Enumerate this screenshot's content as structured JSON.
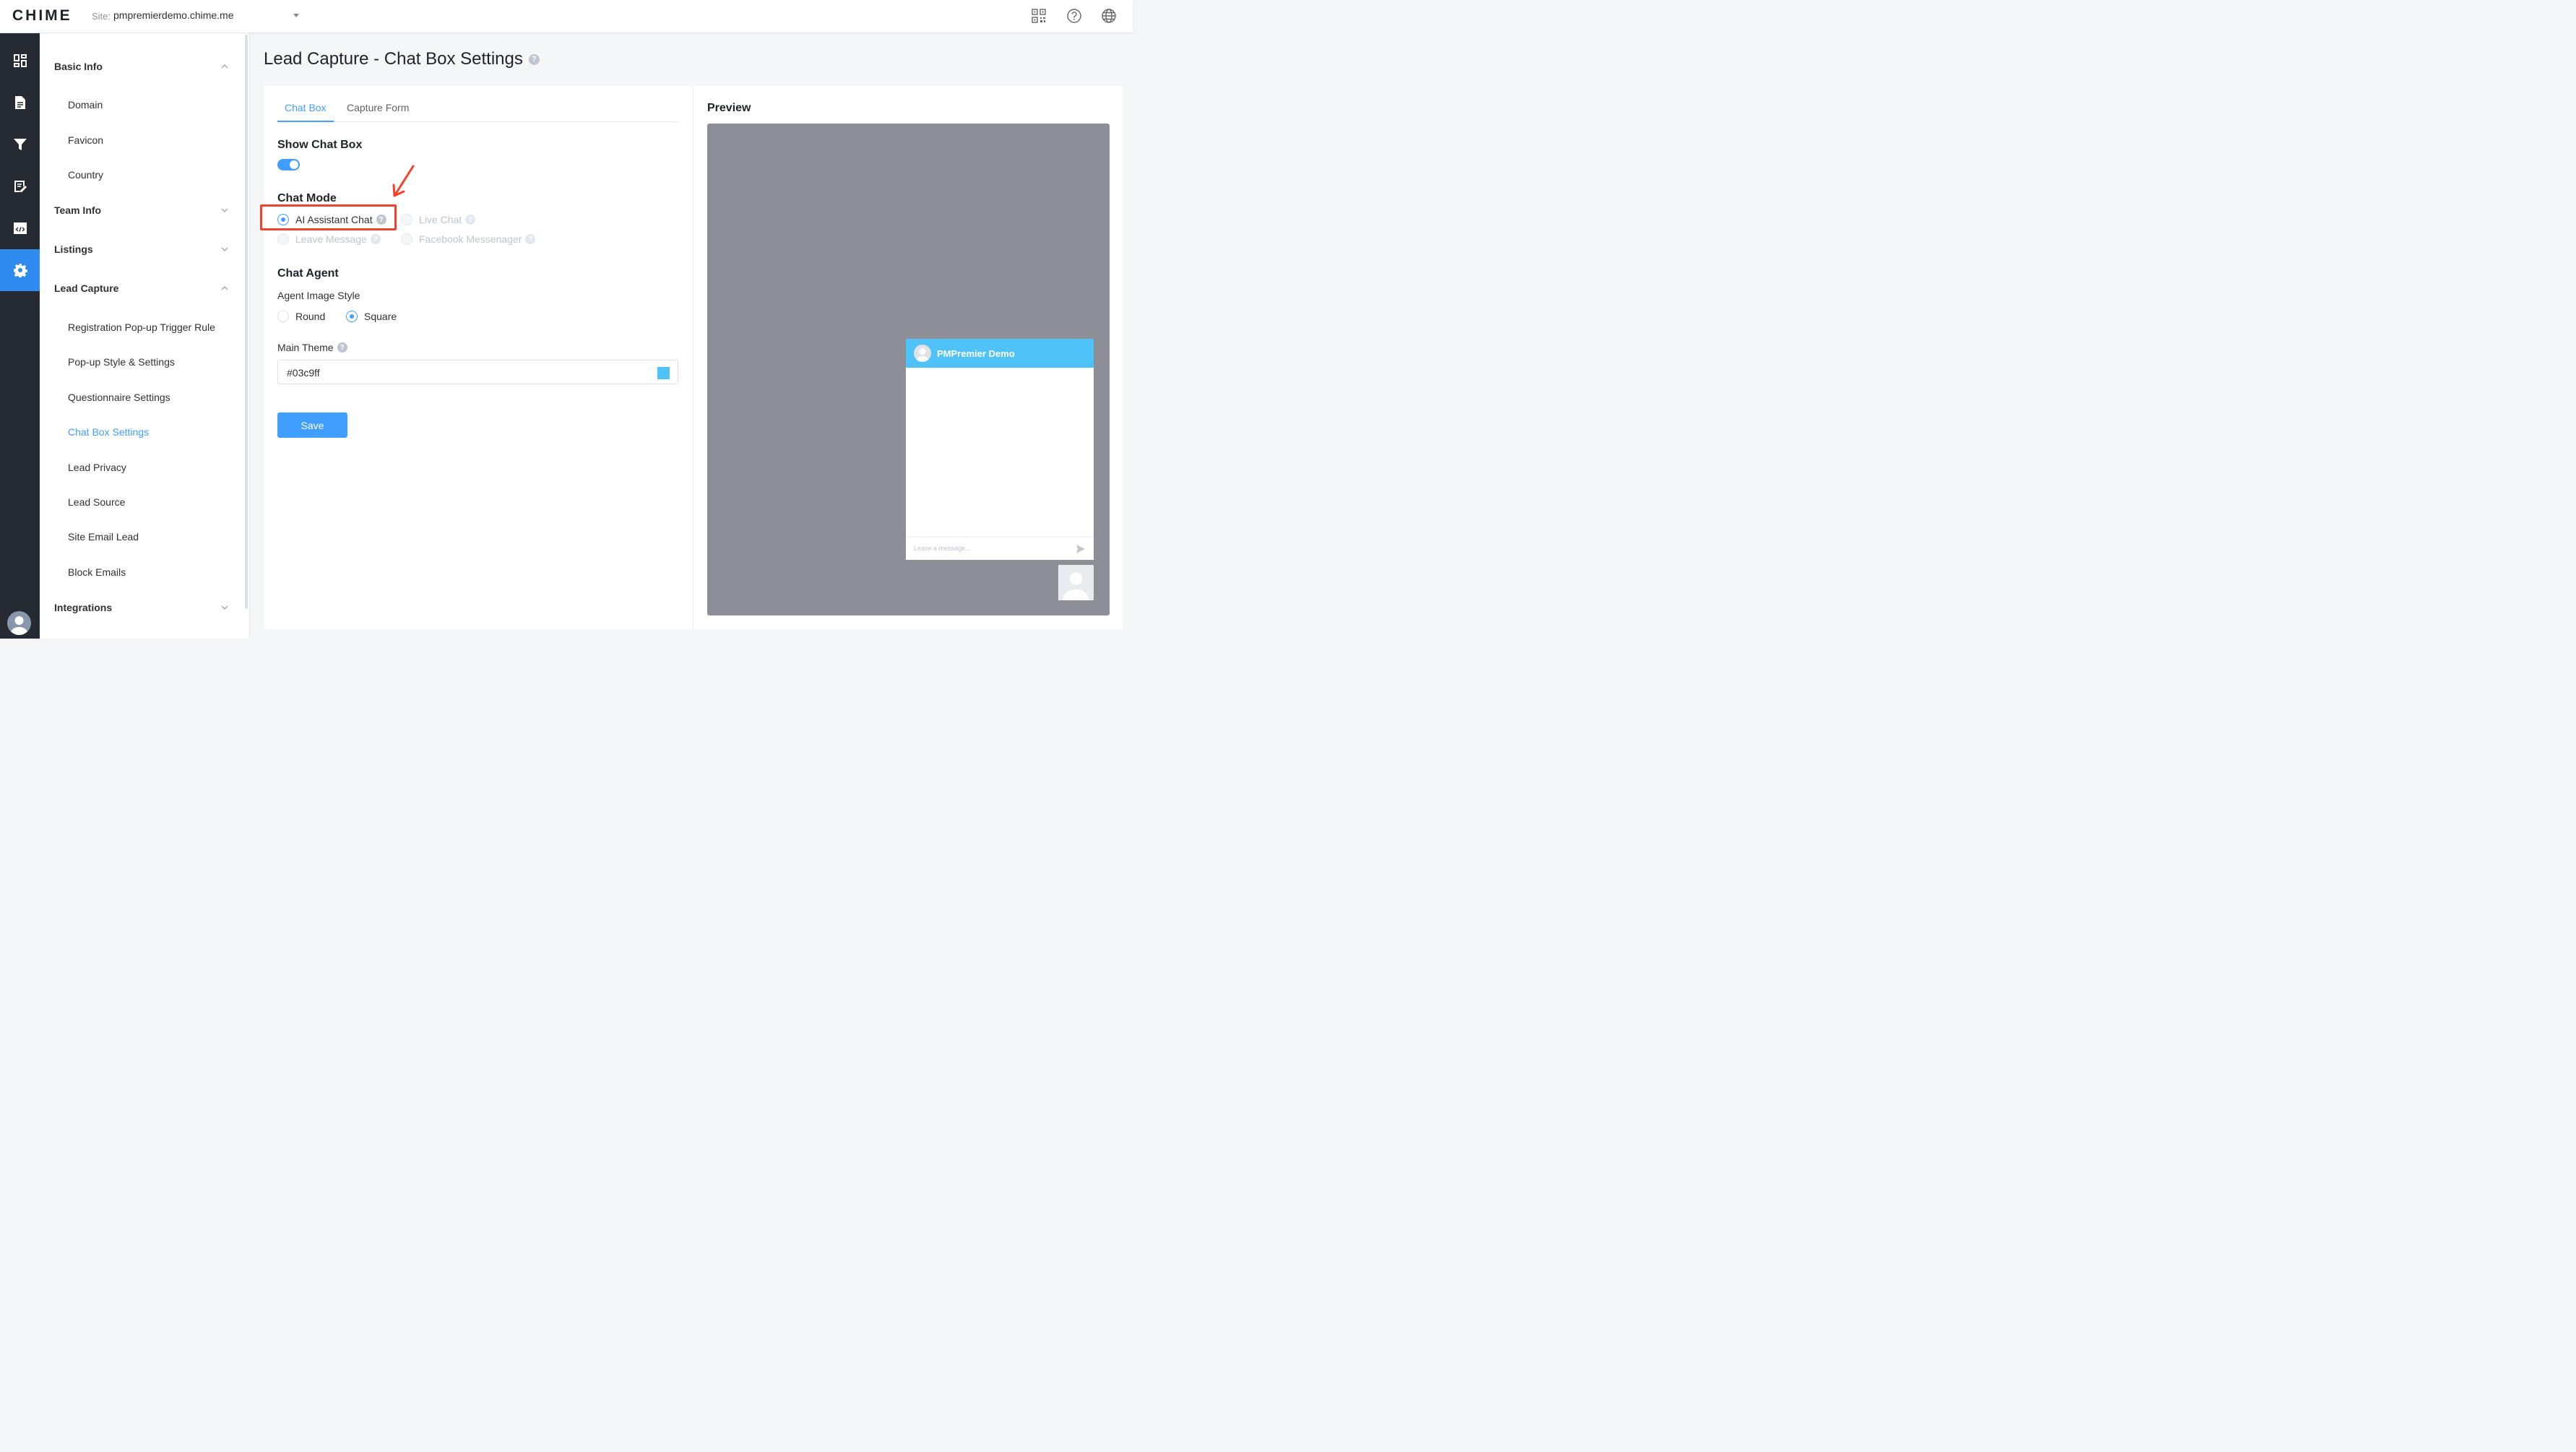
{
  "app": {
    "logo": "CHIME"
  },
  "header": {
    "site_label": "Site:",
    "site_value": "pmpremierdemo.chime.me",
    "icons": [
      "qr-code-icon",
      "help-icon",
      "globe-icon"
    ]
  },
  "rail": {
    "items": [
      "dashboard-icon",
      "document-icon",
      "filter-icon",
      "edit-note-icon",
      "code-icon",
      "settings-icon"
    ],
    "active": "settings-icon"
  },
  "subnav": {
    "groups": [
      {
        "label": "Basic Info",
        "expanded": true,
        "items": [
          "Domain",
          "Favicon",
          "Country"
        ]
      },
      {
        "label": "Team Info",
        "expanded": false,
        "items": []
      },
      {
        "label": "Listings",
        "expanded": false,
        "items": []
      },
      {
        "label": "Lead Capture",
        "expanded": true,
        "items": [
          "Registration Pop-up Trigger Rule",
          "Pop-up Style & Settings",
          "Questionnaire Settings",
          "Chat Box Settings",
          "Lead Privacy",
          "Lead Source",
          "Site Email Lead",
          "Block Emails"
        ]
      },
      {
        "label": "Integrations",
        "expanded": false,
        "items": []
      }
    ],
    "active_item": "Chat Box Settings"
  },
  "page": {
    "title": "Lead Capture - Chat Box Settings",
    "help_mark": "?",
    "tabs": [
      {
        "label": "Chat Box",
        "active": true
      },
      {
        "label": "Capture Form",
        "active": false
      }
    ],
    "show_chat_box": {
      "title": "Show Chat Box",
      "enabled": true
    },
    "chat_mode": {
      "title": "Chat Mode",
      "options": [
        {
          "label": "AI Assistant Chat",
          "checked": true,
          "disabled": false
        },
        {
          "label": "Live Chat",
          "checked": false,
          "disabled": true
        },
        {
          "label": "Leave Message",
          "checked": false,
          "disabled": true
        },
        {
          "label": "Facebook Messenager",
          "checked": false,
          "disabled": true
        }
      ]
    },
    "chat_agent": {
      "title": "Chat Agent",
      "image_style_label": "Agent Image Style",
      "image_style_options": [
        {
          "label": "Round",
          "checked": false
        },
        {
          "label": "Square",
          "checked": true
        }
      ]
    },
    "main_theme": {
      "label": "Main Theme",
      "value": "#03c9ff",
      "swatch_color": "#4fc3f7"
    },
    "save_label": "Save"
  },
  "preview": {
    "title": "Preview",
    "chat_name": "PMPremier Demo",
    "input_placeholder": "Leave a message...",
    "header_color": "#4fc3f7"
  },
  "annotation": {
    "color": "#f0432e"
  }
}
